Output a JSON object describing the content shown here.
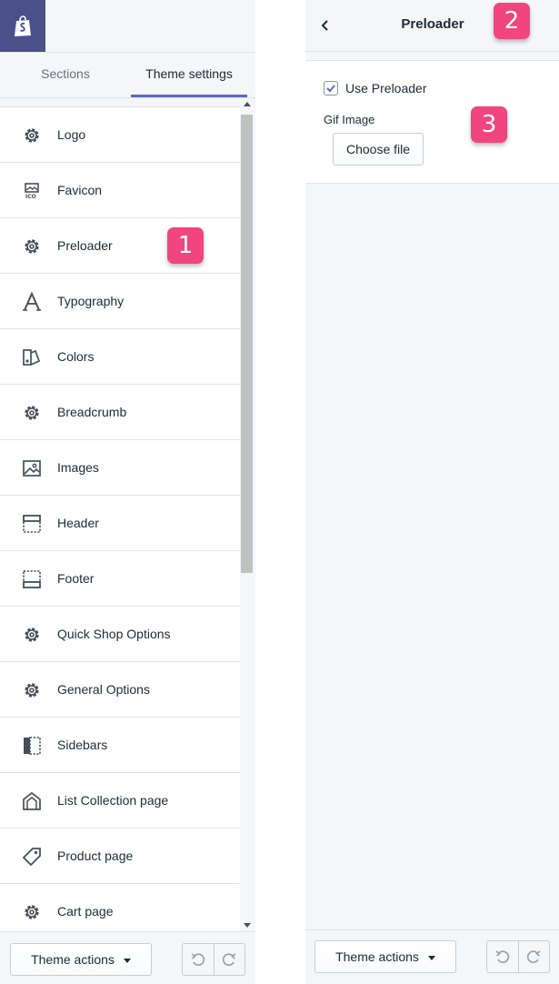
{
  "tabs": {
    "sections": "Sections",
    "theme_settings": "Theme settings"
  },
  "settings_list": [
    {
      "label": "Logo",
      "icon": "gear-icon"
    },
    {
      "label": "Favicon",
      "icon": "favicon-icon"
    },
    {
      "label": "Preloader",
      "icon": "gear-icon"
    },
    {
      "label": "Typography",
      "icon": "typography-icon"
    },
    {
      "label": "Colors",
      "icon": "colors-icon"
    },
    {
      "label": "Breadcrumb",
      "icon": "gear-icon"
    },
    {
      "label": "Images",
      "icon": "image-icon"
    },
    {
      "label": "Header",
      "icon": "header-icon"
    },
    {
      "label": "Footer",
      "icon": "footer-icon"
    },
    {
      "label": "Quick Shop Options",
      "icon": "gear-icon"
    },
    {
      "label": "General Options",
      "icon": "gear-icon"
    },
    {
      "label": "Sidebars",
      "icon": "sidebar-icon"
    },
    {
      "label": "List Collection page",
      "icon": "collection-icon"
    },
    {
      "label": "Product page",
      "icon": "tag-icon"
    },
    {
      "label": "Cart page",
      "icon": "gear-icon"
    }
  ],
  "footer": {
    "theme_actions_label": "Theme actions"
  },
  "detail": {
    "title": "Preloader",
    "use_preloader_label": "Use Preloader",
    "use_preloader_checked": true,
    "gif_image_label": "Gif Image",
    "choose_file_label": "Choose file"
  },
  "markers": {
    "m1": "1",
    "m2": "2",
    "m3": "3"
  },
  "colors": {
    "brand": "#4b4f8a",
    "tab_underline": "#5c6ac4",
    "marker": "#f0457f"
  }
}
